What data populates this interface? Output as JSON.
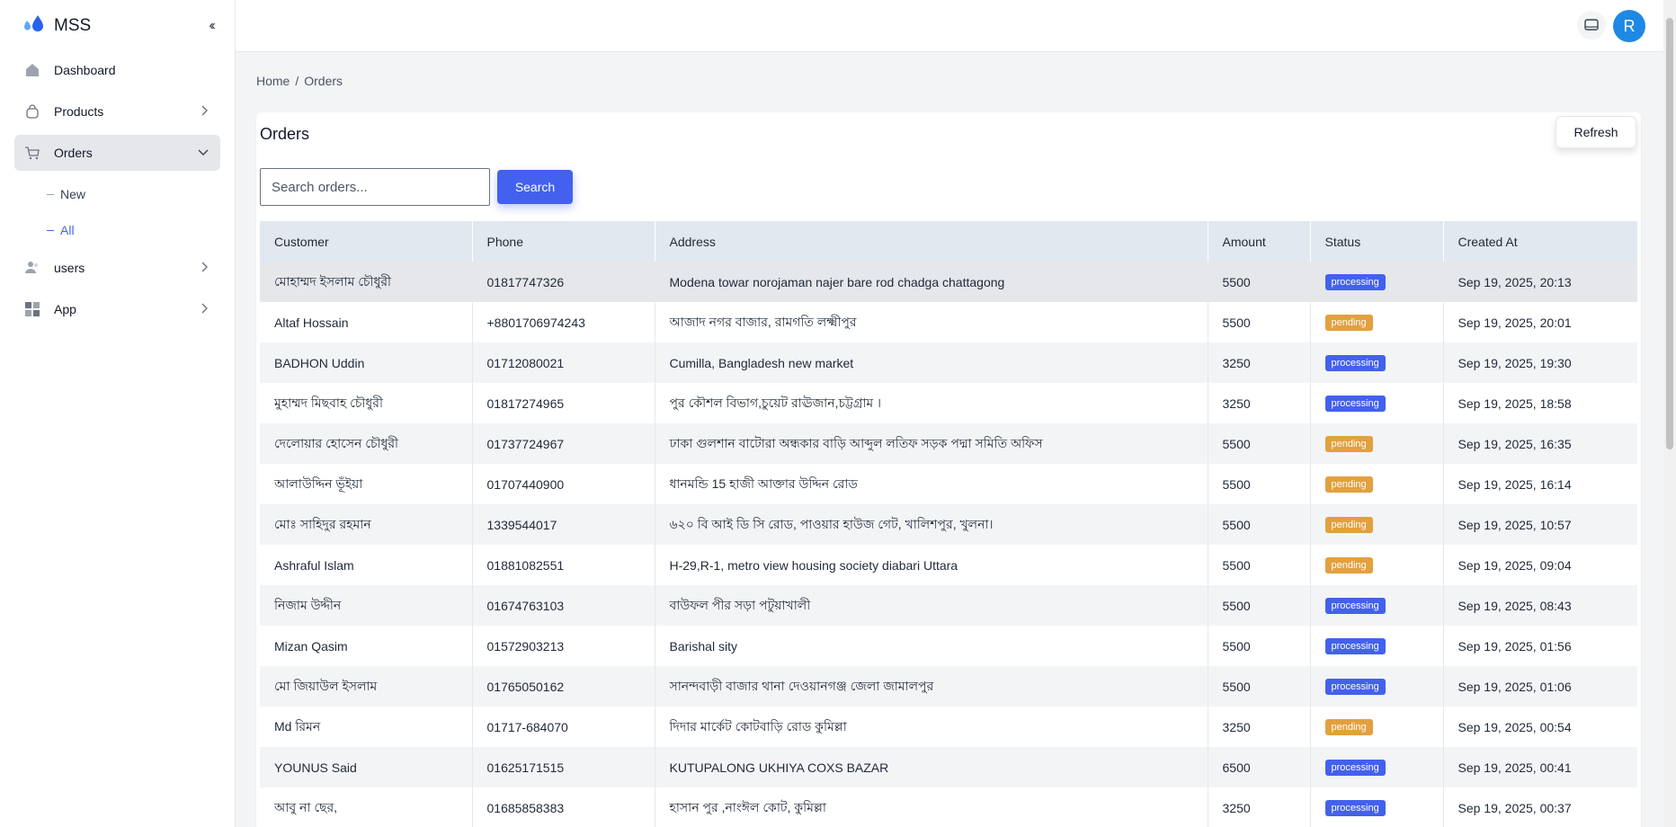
{
  "brand": {
    "name": "MSS",
    "logo_text": "Water"
  },
  "sidebar": {
    "items": [
      {
        "label": "Dashboard",
        "icon": "home-icon"
      },
      {
        "label": "Products",
        "icon": "bag-icon"
      },
      {
        "label": "Orders",
        "icon": "cart-icon"
      },
      {
        "label": "users",
        "icon": "users-icon"
      },
      {
        "label": "App",
        "icon": "grid-icon"
      }
    ],
    "orders_sub": [
      {
        "label": "New"
      },
      {
        "label": "All"
      }
    ]
  },
  "header": {
    "avatar_letter": "R"
  },
  "breadcrumb": {
    "home": "Home",
    "sep": "/",
    "current": "Orders"
  },
  "panel": {
    "title": "Orders",
    "refresh_label": "Refresh"
  },
  "search": {
    "placeholder": "Search orders...",
    "button_label": "Search"
  },
  "table": {
    "columns": [
      "Customer",
      "Phone",
      "Address",
      "Amount",
      "Status",
      "Created At"
    ],
    "rows": [
      [
        "মোহাম্মদ ইসলাম চৌধুরী",
        "01817747326",
        "Modena towar norojaman najer bare rod chadga chattagong",
        "5500",
        "processing",
        "Sep 19, 2025, 20:13"
      ],
      [
        "Altaf Hossain",
        "+8801706974243",
        "আজাদ নগর বাজার, রামগতি লক্ষ্মীপুর",
        "5500",
        "pending",
        "Sep 19, 2025, 20:01"
      ],
      [
        "BADHON Uddin",
        "01712080021",
        "Cumilla, Bangladesh new market",
        "3250",
        "processing",
        "Sep 19, 2025, 19:30"
      ],
      [
        "মুহাম্মদ মিছবাহ চৌধুরী",
        "01817274965",
        "পুর কৌশল বিভাগ,চুয়েট রাঊজান,চট্টগ্রাম ।",
        "3250",
        "processing",
        "Sep 19, 2025, 18:58"
      ],
      [
        "দেলোয়ার হোসেন চৌধুরী",
        "01737724967",
        "ঢাকা গুলশান বাটোরা অন্ধকার বাড়ি আব্দুল লতিফ সড়ক পদ্মা সমিতি অফিস",
        "5500",
        "pending",
        "Sep 19, 2025, 16:35"
      ],
      [
        "আলাউদ্দিন ভূঁইয়া",
        "01707440900",
        "ধানমন্ডি 15 হাজী আক্তার উদ্দিন রোড",
        "5500",
        "pending",
        "Sep 19, 2025, 16:14"
      ],
      [
        "মোঃ সাহিদুর রহমান",
        "1339544017",
        "৬২০ বি আই ডি সি রোড, পাওয়ার হাউজ গেট, খালিশপুর, খুলনা।",
        "5500",
        "pending",
        "Sep 19, 2025, 10:57"
      ],
      [
        "Ashraful Islam",
        "01881082551",
        "H-29,R-1, metro view housing society diabari Uttara",
        "5500",
        "pending",
        "Sep 19, 2025, 09:04"
      ],
      [
        "নিজাম উদ্দীন",
        "01674763103",
        "বাউফল পীর সড়া পটুয়াখালী",
        "5500",
        "processing",
        "Sep 19, 2025, 08:43"
      ],
      [
        "Mizan Qasim",
        "01572903213",
        "Barishal sity",
        "5500",
        "processing",
        "Sep 19, 2025, 01:56"
      ],
      [
        "মো জিয়াউল ইসলাম",
        "01765050162",
        "সানন্দবাড়ী বাজার থানা দেওয়ানগঞ্জ জেলা জামালপুর",
        "5500",
        "processing",
        "Sep 19, 2025, 01:06"
      ],
      [
        "Md রিমন",
        "01717-684070",
        "দিদার মার্কেট কোটবাড়ি রোড কুমিল্লা",
        "3250",
        "pending",
        "Sep 19, 2025, 00:54"
      ],
      [
        "YOUNUS Said",
        "01625171515",
        "KUTUPALONG UKHIYA COXS BAZAR",
        "6500",
        "processing",
        "Sep 19, 2025, 00:41"
      ],
      [
        "আবু না ছের,",
        "01685858383",
        "হাসান পুর ,নাংঈল কোট, কুমিল্লা",
        "3250",
        "processing",
        "Sep 19, 2025, 00:37"
      ]
    ]
  },
  "colors": {
    "accent": "#4361ee",
    "pending": "#e2a03f",
    "avatar": "#1e88e5"
  }
}
